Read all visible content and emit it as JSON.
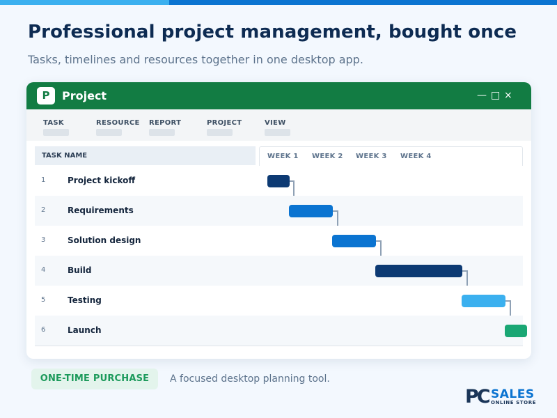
{
  "hero": {
    "headline": "Professional project management, bought once",
    "subline": "Tasks, timelines and resources together in one desktop app."
  },
  "window": {
    "logo_letter": "P",
    "title": "Project",
    "minimize_glyph": "—",
    "maximize_glyph": "□",
    "close_glyph": "×"
  },
  "ribbon": {
    "tabs": [
      {
        "label": "TASK"
      },
      {
        "label": "RESOURCE"
      },
      {
        "label": "REPORT"
      },
      {
        "label": "PROJECT"
      },
      {
        "label": "VIEW"
      }
    ]
  },
  "grid": {
    "task_column_header": "TASK NAME",
    "weeks": [
      "WEEK 1",
      "WEEK 2",
      "WEEK 3",
      "WEEK 4"
    ]
  },
  "tasks": [
    {
      "num": "1",
      "name": "Project kickoff"
    },
    {
      "num": "2",
      "name": "Requirements"
    },
    {
      "num": "3",
      "name": "Solution design"
    },
    {
      "num": "4",
      "name": "Build"
    },
    {
      "num": "5",
      "name": "Testing"
    },
    {
      "num": "6",
      "name": "Launch"
    }
  ],
  "gantt_colors": {
    "navy": "#0d3a73",
    "blue": "#0b74d1",
    "sky": "#3bb0ef",
    "green": "#1aa774"
  },
  "footer": {
    "badge": "ONE-TIME PURCHASE",
    "tagline": "A focused desktop planning tool."
  },
  "brand": {
    "pc": "PC",
    "sales": "SALES",
    "store": "ONLINE STORE"
  },
  "colors": {
    "accent": "#0b74d1",
    "window_title_bar": "#127c43",
    "headline": "#0d2b52"
  }
}
